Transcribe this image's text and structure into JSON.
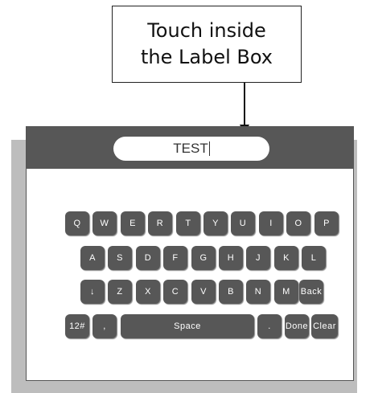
{
  "callout": {
    "line1": "Touch inside",
    "line2": "the Label Box"
  },
  "label_box": {
    "value": "TEST"
  },
  "keyboard": {
    "row1": [
      "Q",
      "W",
      "E",
      "R",
      "T",
      "Y",
      "U",
      "I",
      "O",
      "P"
    ],
    "row2": [
      "A",
      "S",
      "D",
      "F",
      "G",
      "H",
      "J",
      "K",
      "L"
    ],
    "row3": [
      "↓",
      "Z",
      "X",
      "C",
      "V",
      "B",
      "N",
      "M",
      "Back"
    ],
    "row4": [
      "12#",
      ",",
      "Space",
      ".",
      "Done",
      "Clear"
    ]
  }
}
